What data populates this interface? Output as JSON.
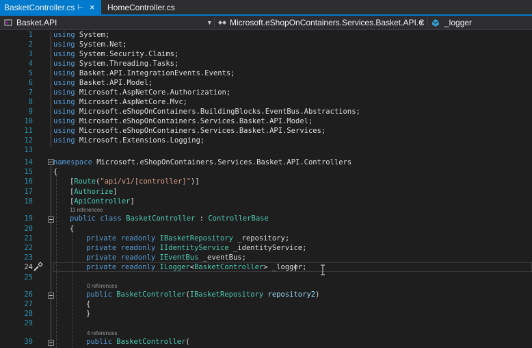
{
  "tabs": [
    {
      "label": "BasketController.cs",
      "active": true
    },
    {
      "label": "HomeController.cs",
      "active": false
    }
  ],
  "nav": {
    "project": "Basket.API",
    "class": "Microsoft.eShopOnContainers.Services.Basket.API.C",
    "member": "_logger"
  },
  "lines": [
    {
      "n": "1",
      "text": "using System;"
    },
    {
      "n": "2",
      "text": "using System.Net;"
    },
    {
      "n": "3",
      "text": "using System.Security.Claims;"
    },
    {
      "n": "4",
      "text": "using System.Threading.Tasks;"
    },
    {
      "n": "5",
      "text": "using Basket.API.IntegrationEvents.Events;"
    },
    {
      "n": "6",
      "text": "using Basket.API.Model;"
    },
    {
      "n": "7",
      "text": "using Microsoft.AspNetCore.Authorization;"
    },
    {
      "n": "8",
      "text": "using Microsoft.AspNetCore.Mvc;"
    },
    {
      "n": "9",
      "text": "using Microsoft.eShopOnContainers.BuildingBlocks.EventBus.Abstractions;"
    },
    {
      "n": "10",
      "text": "using Microsoft.eShopOnContainers.Services.Basket.API.Model;"
    },
    {
      "n": "11",
      "text": "using Microsoft.eShopOnContainers.Services.Basket.API.Services;"
    },
    {
      "n": "12",
      "text": "using Microsoft.Extensions.Logging;"
    },
    {
      "n": "13",
      "text": ""
    },
    {
      "n": "14",
      "text": "namespace Microsoft.eShopOnContainers.Services.Basket.API.Controllers"
    },
    {
      "n": "15",
      "text": "{"
    },
    {
      "n": "16",
      "text": "[Route(\"api/v1/[controller]\")]"
    },
    {
      "n": "17",
      "text": "[Authorize]"
    },
    {
      "n": "18",
      "text": "[ApiController]"
    },
    {
      "n": "19",
      "text": "public class BasketController : ControllerBase"
    },
    {
      "n": "20",
      "text": "{"
    },
    {
      "n": "21",
      "text": "private readonly IBasketRepository _repository;"
    },
    {
      "n": "22",
      "text": "private readonly IIdentityService _identityService;"
    },
    {
      "n": "23",
      "text": "private readonly IEventBus _eventBus;"
    },
    {
      "n": "24",
      "text": "private readonly ILogger<BasketController> _logger;"
    },
    {
      "n": "25",
      "text": ""
    },
    {
      "n": "26",
      "text": "public BasketController(IBasketRepository repository2)"
    },
    {
      "n": "27",
      "text": "{"
    },
    {
      "n": "28",
      "text": "}"
    },
    {
      "n": "29",
      "text": ""
    },
    {
      "n": "30",
      "text": "public BasketController("
    }
  ],
  "hints": {
    "class_refs": "11 references",
    "ctor1_refs": "0 references",
    "ctor2_refs": "4 references"
  },
  "colors": {
    "accent": "#007acc",
    "keyword": "#569cd6",
    "type": "#4ec9b0",
    "string": "#d69d85",
    "line_number": "#2b91af"
  },
  "icons": {
    "tab_pin": "pin-icon",
    "tab_close": "close-icon",
    "project": "csharp-project-icon",
    "class": "class-icon",
    "member": "field-icon",
    "quick_action": "screwdriver-icon"
  }
}
